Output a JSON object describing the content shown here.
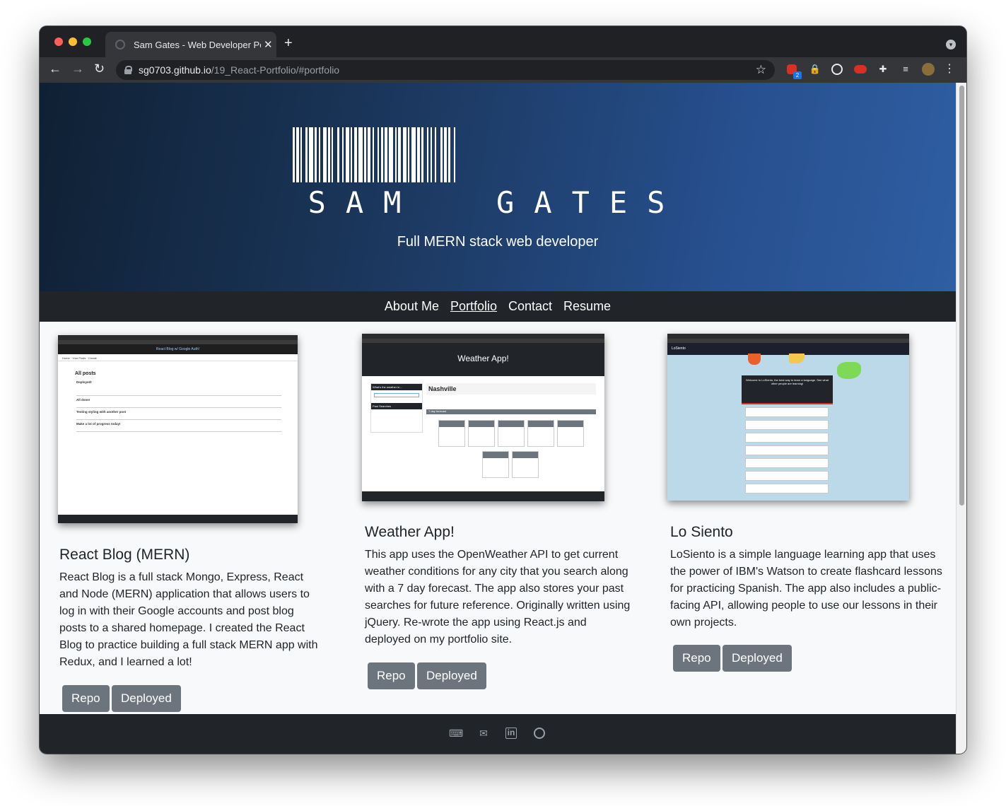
{
  "browser": {
    "tab_title": "Sam Gates - Web Developer Portfolio",
    "new_tab": "+",
    "close": "✕",
    "url_host": "sg0703.github.io",
    "url_path": "/19_React-Portfolio/#portfolio",
    "extension_badge": "2"
  },
  "hero": {
    "name": "SAM  GATES",
    "tagline": "Full MERN stack web developer"
  },
  "nav": {
    "items": [
      "About Me",
      "Portfolio",
      "Contact",
      "Resume"
    ],
    "active": "Portfolio"
  },
  "projects": [
    {
      "title": "React Blog (MERN)",
      "description": "React Blog is a full stack Mongo, Express, React and Node (MERN) application that allows users to log in with their Google accounts and post blog posts to a shared homepage. I created the React Blog to practice building a full stack MERN app with Redux, and I learned a lot!",
      "repo_label": "Repo",
      "deployed_label": "Deployed",
      "screenshot": {
        "header": "React Blog w/ Google Auth!",
        "heading": "All posts",
        "posts": [
          "Deployed!",
          "All done!",
          "Testing styling with another post",
          "Make a lot of progress today!"
        ]
      }
    },
    {
      "title": "Weather App!",
      "description": "This app uses the OpenWeather API to get current weather conditions for any city that you search along with a 7 day forecast. The app also stores your past searches for future reference. Originally written using jQuery. Re-wrote the app using React.js and deployed on my portfolio site.",
      "repo_label": "Repo",
      "deployed_label": "Deployed",
      "screenshot": {
        "header": "Weather App!",
        "city": "Nashville",
        "forecast_label": "7 day forecast",
        "search_label": "What's the weather in...",
        "past_label": "Past Searches"
      }
    },
    {
      "title": "Lo Siento",
      "description": "LoSiento is a simple language learning app that uses the power of IBM's Watson to create flashcard lessons for practicing Spanish. The app also includes a public-facing API, allowing people to use our lessons in their own projects.",
      "repo_label": "Repo",
      "deployed_label": "Deployed",
      "screenshot": {
        "brand": "LoSiento",
        "welcome": "Welcome to LoSiento, the best way to learn a language. See what other people are learning!"
      }
    }
  ],
  "footer": {
    "icons": [
      "keyboard-icon",
      "email-icon",
      "linkedin-icon",
      "github-icon"
    ]
  }
}
